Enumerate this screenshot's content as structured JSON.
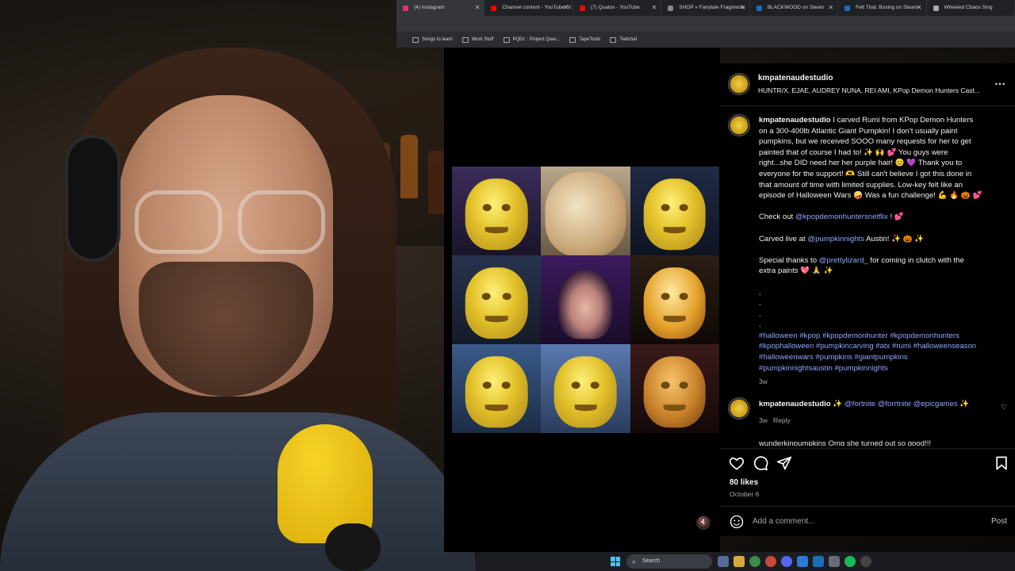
{
  "tabs": [
    {
      "label": "(4) Instagram",
      "active": true,
      "color": "#e1306c"
    },
    {
      "label": "Channel content - YouTube St",
      "active": false,
      "color": "#ff0000"
    },
    {
      "label": "(7) Quatos - YouTube",
      "active": false,
      "color": "#ff0000"
    },
    {
      "label": "SHOP » Fairytale Fragments",
      "active": false,
      "color": "#888888"
    },
    {
      "label": "BLACKWOOD on Steam",
      "active": false,
      "color": "#1b6fb8"
    },
    {
      "label": "Felt That: Boxing on Steam",
      "active": false,
      "color": "#1b6fb8"
    },
    {
      "label": "Wheeled Chaos Sing",
      "active": false,
      "color": "#aaaaaa"
    }
  ],
  "bookmarks": [
    "Songs to learn",
    "Work Stuff",
    "PQDI :: Project Quar...",
    "TapeTools",
    "Twitchat"
  ],
  "post": {
    "username": "kmpatenaudestudio",
    "header_sub": "HUNTR/X, EJAE, AUDREY NUNA, REI AMI, KPop Demon Hunters Cast...",
    "caption_lines": [
      "I carved Rumi from KPop Demon Hunters",
      "on a 300-400lb Atlantic Giant Pumpkin! I don't usually paint",
      "pumpkins, but we received SOOO many requests for her to get",
      "painted that of course I had to! ✨ 🙌 💕 You guys were",
      "right...she DID need her her purple hair! 😊 💜 Thank you to",
      "everyone for the support! 🫶 Still can't believe I got this done in",
      "that amount of time with limited supplies. Low-key felt like an",
      "episode of Halloween Wars 🤪 Was a fun challenge! 💪 🔥 🎃 💕"
    ],
    "check_out_prefix": "Check out",
    "check_out_link": "@kpopdemonhuntersnetflix",
    "check_out_suffix": "! 💕",
    "carved_prefix": "Carved live at",
    "carved_link": "@pumpkinnights",
    "carved_suffix": "Austin! ✨ 🎃 ✨",
    "thanks_prefix": "Special thanks to",
    "thanks_link": "@prettylizard_",
    "thanks_suffix": "for coming in clutch with the",
    "thanks_line2": "extra paints 💖 🙏 ✨",
    "dots": [
      ".",
      ".",
      ".",
      "."
    ],
    "hashtags_lines": [
      "#halloween #kpop #kpopdemonhunter #kpopdemonhunters",
      "#kpophalloween #pumpkincarving #atx #rumi #halloweenseason",
      "#halloweenwars #pumpkins #giantpumpkins",
      "#pumpkinnightsaustin #pumpkinnights"
    ],
    "caption_age": "3w"
  },
  "comment": {
    "username": "kmpatenaudestudio",
    "text_prefix": "✨",
    "links": "@fortnite @forrtnite @epicgames",
    "text_suffix": "✨",
    "age": "3w",
    "reply": "Reply",
    "next_preview": "wunderkinpumpkins Omg she turned out so good!!!"
  },
  "stats": {
    "likes": "80 likes",
    "date": "October 6"
  },
  "composer": {
    "placeholder": "Add a comment...",
    "post": "Post"
  },
  "taskbar": {
    "search": "Search"
  },
  "icons": {
    "like": "heart-icon",
    "comment": "comment-icon",
    "share": "share-icon",
    "save": "bookmark-icon",
    "emoji": "emoji-icon",
    "mute": "muted-speaker-icon",
    "more": "more-options-icon"
  }
}
